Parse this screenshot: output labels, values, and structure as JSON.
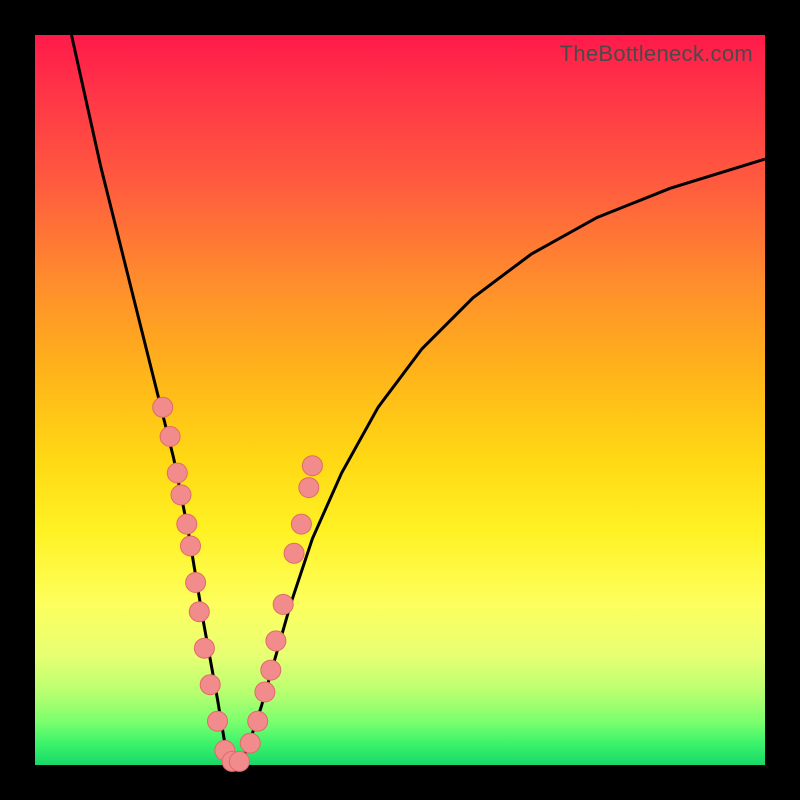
{
  "watermark": "TheBottleneck.com",
  "colors": {
    "curve": "#000000",
    "marker_fill": "#f28b8b",
    "marker_stroke": "#e06a6a",
    "gradient_top": "#ff1a4a",
    "gradient_bottom": "#18d868",
    "frame": "#000000"
  },
  "chart_data": {
    "type": "line",
    "title": "",
    "xlabel": "",
    "ylabel": "",
    "xlim": [
      0,
      100
    ],
    "ylim": [
      0,
      100
    ],
    "x_min_point": 27,
    "curve_points_xy": [
      [
        5,
        100
      ],
      [
        7,
        91
      ],
      [
        9,
        82
      ],
      [
        11,
        74
      ],
      [
        13,
        66
      ],
      [
        15,
        58
      ],
      [
        17,
        50
      ],
      [
        19,
        42
      ],
      [
        21,
        32
      ],
      [
        23,
        20
      ],
      [
        25,
        9
      ],
      [
        26,
        3
      ],
      [
        27,
        0
      ],
      [
        28,
        0.5
      ],
      [
        29,
        2
      ],
      [
        31,
        8
      ],
      [
        33,
        15
      ],
      [
        35,
        22
      ],
      [
        38,
        31
      ],
      [
        42,
        40
      ],
      [
        47,
        49
      ],
      [
        53,
        57
      ],
      [
        60,
        64
      ],
      [
        68,
        70
      ],
      [
        77,
        75
      ],
      [
        87,
        79
      ],
      [
        100,
        83
      ]
    ],
    "marker_points_xy": [
      [
        17.5,
        49
      ],
      [
        18.5,
        45
      ],
      [
        19.5,
        40
      ],
      [
        20.0,
        37
      ],
      [
        20.8,
        33
      ],
      [
        21.3,
        30
      ],
      [
        22.0,
        25
      ],
      [
        22.5,
        21
      ],
      [
        23.2,
        16
      ],
      [
        24.0,
        11
      ],
      [
        25.0,
        6
      ],
      [
        26.0,
        2
      ],
      [
        27.0,
        0.5
      ],
      [
        28.0,
        0.5
      ],
      [
        29.5,
        3
      ],
      [
        30.5,
        6
      ],
      [
        31.5,
        10
      ],
      [
        32.3,
        13
      ],
      [
        33.0,
        17
      ],
      [
        34.0,
        22
      ],
      [
        35.5,
        29
      ],
      [
        36.5,
        33
      ],
      [
        37.5,
        38
      ],
      [
        38.0,
        41
      ]
    ]
  }
}
